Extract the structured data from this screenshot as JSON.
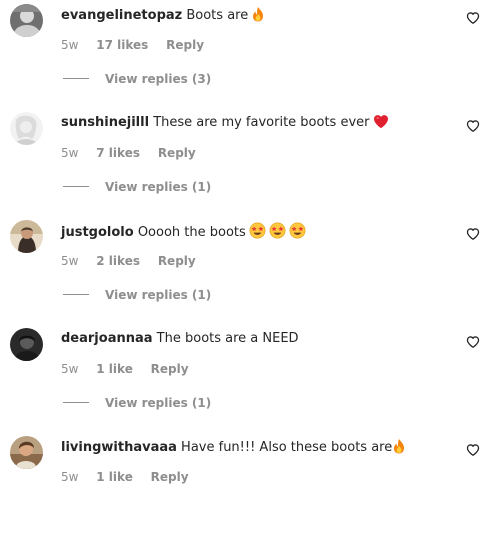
{
  "comments": [
    {
      "username": "evangelinetopaz",
      "text": "Boots are",
      "emojis": [
        "fire"
      ],
      "time": "5w",
      "likes": "17 likes",
      "reply": "Reply",
      "view_replies": "View replies (3)"
    },
    {
      "username": "sunshinejilll",
      "text": "These are my favorite boots ever",
      "emojis": [
        "red-heart"
      ],
      "time": "5w",
      "likes": "7 likes",
      "reply": "Reply",
      "view_replies": "View replies (1)"
    },
    {
      "username": "justgololo",
      "text": "Ooooh the boots",
      "emojis": [
        "star-struck",
        "star-struck",
        "star-struck"
      ],
      "time": "5w",
      "likes": "2 likes",
      "reply": "Reply",
      "view_replies": "View replies (1)"
    },
    {
      "username": "dearjoannaa",
      "text": "The boots are a NEED",
      "emojis": [],
      "time": "5w",
      "likes": "1 like",
      "reply": "Reply",
      "view_replies": "View replies (1)"
    },
    {
      "username": "livingwithavaaa",
      "text": "Have fun!!! Also these boots are",
      "emojis": [
        "fire"
      ],
      "time": "5w",
      "likes": "1 like",
      "reply": "Reply",
      "view_replies": ""
    }
  ],
  "icons": {
    "like": "heart-outline-icon"
  },
  "colors": {
    "text": "#262626",
    "secondary": "#8e8e8e",
    "background": "#ffffff"
  }
}
